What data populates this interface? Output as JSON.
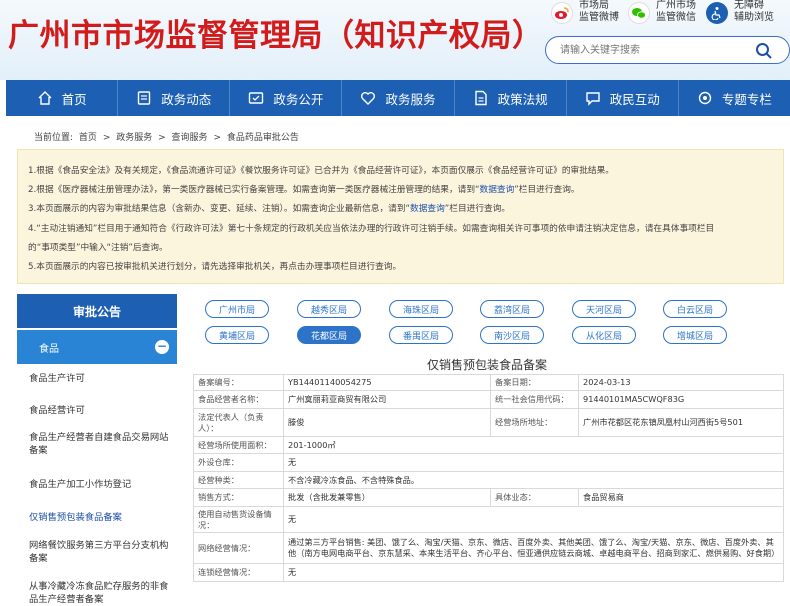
{
  "header": {
    "title": "广州市市场监督管理局（知识产权局）",
    "quick_links": [
      {
        "label": "市场局\n监管微博",
        "icon": "weibo-icon"
      },
      {
        "label": "广州市场\n监管微信",
        "icon": "wechat-icon"
      },
      {
        "label": "无障碍\n辅助浏览",
        "icon": "accessibility-icon"
      }
    ],
    "search": {
      "placeholder": "请输入关键字搜索"
    }
  },
  "nav": {
    "items": [
      {
        "label": "首页",
        "icon": "home-icon"
      },
      {
        "label": "政务动态",
        "icon": "news-icon"
      },
      {
        "label": "政务公开",
        "icon": "open-icon"
      },
      {
        "label": "政务服务",
        "icon": "service-icon"
      },
      {
        "label": "政策法规",
        "icon": "policy-icon"
      },
      {
        "label": "政民互动",
        "icon": "interaction-icon"
      },
      {
        "label": "专题专栏",
        "icon": "topic-icon"
      }
    ]
  },
  "breadcrumb": [
    "当前位置:",
    "首页",
    ">",
    "政务服务",
    ">",
    "查询服务",
    ">",
    "食品药品审批公告"
  ],
  "notice": {
    "lines": [
      [
        "1.根据《食品安全法》及有关规定，《食品流通许可证》《餐饮服务许可证》已合并为《食品经营许可证》，本页面仅展示《食品经营许可证》的审批结果。"
      ],
      [
        "2.根据《医疗器械注册管理办法》，第一类医疗器械已实行备案管理。如需查询第一类医疗器械注册管理的结果，请到“",
        "数据查询",
        "”栏目进行查询。"
      ],
      [
        "3.本页面展示的内容为审批结果信息（含新办、变更、延续、注销）。如需查询企业最新信息，请到“",
        "数据查询",
        "”栏目进行查询。"
      ],
      [
        "4.“主动注销通知”栏目用于通知符合《行政许可法》第七十条规定的行政机关应当依法办理的行政许可注销手续。如需查询相关许可事项的依申请注销决定信息，请在具体事项栏目"
      ],
      [
        "的“事项类型”中输入“注销”后查询。"
      ],
      [
        "5.本页面展示的内容已按审批机关进行划分，请先选择审批机关，再点击办理事项栏目进行查询。"
      ]
    ]
  },
  "sidebar": {
    "heading": "审批公告",
    "category": "食品",
    "items": [
      "食品生产许可",
      "食品经营许可",
      "食品生产经营者自建食品交易网站备案",
      "食品生产加工小作坊登记",
      "仅销售预包装食品备案",
      "网络餐饮服务第三方平台分支机构备案",
      "从事冷藏冷冻食品贮存服务的非食品生产经营者备案"
    ]
  },
  "districts": {
    "items": [
      "广州市局",
      "越秀区局",
      "海珠区局",
      "荔湾区局",
      "天河区局",
      "白云区局",
      "黄埔区局",
      "花都区局",
      "番禺区局",
      "南沙区局",
      "从化区局",
      "增城区局"
    ],
    "active": "花都区局"
  },
  "record": {
    "title": "仅销售预包装食品备案",
    "rows": [
      {
        "type": "pair",
        "l1": "备案编号：",
        "v1": "YB14401140054275",
        "l2": "备案日期：",
        "v2": "2024-03-13"
      },
      {
        "type": "pair",
        "l1": "食品经营者名称：",
        "v1": "广州寞丽莉亚商贸有限公司",
        "l2": "统一社会信用代码：",
        "v2": "91440101MA5CWQF83G"
      },
      {
        "type": "pair",
        "l1": "法定代表人（负责人）：",
        "v1": "滕俊",
        "l2": "经营场所地址：",
        "v2": "广州市花都区花东镇凤凰村山河西街5号501"
      },
      {
        "type": "full",
        "l1": "经营场所使用面积：",
        "v1": "201-1000㎡"
      },
      {
        "type": "full",
        "l1": "外设仓库：",
        "v1": "无"
      },
      {
        "type": "full",
        "l1": "经营种类：",
        "v1": "不含冷藏冷冻食品、不含特殊食品。"
      },
      {
        "type": "pair",
        "l1": "销售方式：",
        "v1": "批发（含批发兼零售）",
        "l2": "具体业态：",
        "v2": "食品贸易商"
      },
      {
        "type": "full",
        "l1": "使用自动售货设备情况：",
        "v1": "无"
      },
      {
        "type": "full",
        "l1": "网络经营情况：",
        "v1": "通过第三方平台销售: 美团、饿了么、淘宝/天猫、京东、微店、百度外卖、其他美团、饿了么、淘宝/天猫、京东、微店、百度外卖、其他（南方电网电商平台、京东慧采、本来生活平台、齐心平台、恒亚通供应链云商城、卓越电商平台、招商到家汇、燃供易购、好食期）"
      },
      {
        "type": "full",
        "l1": "连锁经营情况：",
        "v1": "无"
      }
    ]
  }
}
